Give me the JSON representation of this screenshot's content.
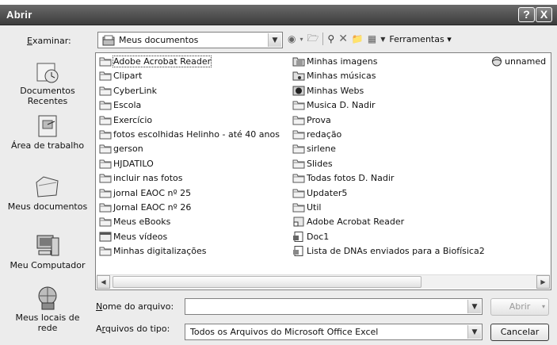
{
  "window": {
    "title": "Abrir",
    "help_btn": "?",
    "close_btn": "X"
  },
  "look_in": {
    "label": "Examinar:",
    "value": "Meus documentos"
  },
  "toolbar": {
    "tools_label": "Ferramentas"
  },
  "places": [
    {
      "name": "place-recent",
      "label": "Documentos Recentes"
    },
    {
      "name": "place-desktop",
      "label": "Área de trabalho"
    },
    {
      "name": "place-mydocs",
      "label": "Meus documentos"
    },
    {
      "name": "place-mycomputer",
      "label": "Meu Computador"
    },
    {
      "name": "place-network",
      "label": "Meus locais de rede"
    }
  ],
  "files": {
    "col1": [
      "Adobe Acrobat Reader",
      "Clipart",
      "CyberLink",
      "Escola",
      "Exercício",
      "fotos escolhidas Helinho - até 40 anos",
      "gerson",
      "HJDATILO",
      "incluir nas fotos",
      "jornal EAOC nº 25",
      "Jornal EAOC nº 26",
      "Meus eBooks",
      "Meus vídeos",
      "Minhas digitalizações"
    ],
    "col2": [
      "Minhas imagens",
      "Minhas músicas",
      "Minhas Webs",
      "Musica D. Nadir",
      "Prova",
      "redação",
      "sirlene",
      "Slides",
      "Todas fotos D. Nadir",
      "Updater5",
      "Util",
      "Adobe Acrobat Reader",
      "Doc1",
      "Lista de DNAs enviados para a Biofísica2"
    ],
    "col3": [
      "unnamed"
    ]
  },
  "filename": {
    "label": "Nome do arquivo:",
    "value": ""
  },
  "filetype": {
    "label": "Arquivos do tipo:",
    "value": "Todos os Arquivos do Microsoft Office Excel"
  },
  "buttons": {
    "open": "Abrir",
    "cancel": "Cancelar"
  }
}
